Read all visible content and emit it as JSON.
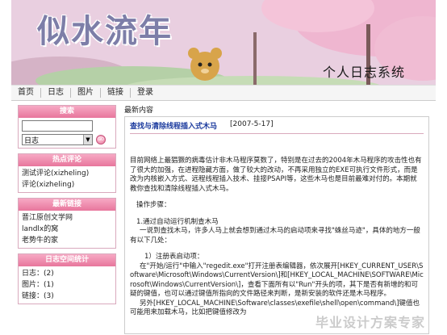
{
  "banner": {
    "title": "似水流年",
    "subtitle": "个人日志系统"
  },
  "nav": [
    "首页",
    "日志",
    "图片",
    "链接",
    "登录"
  ],
  "sidebar": {
    "search": {
      "heading": "搜索",
      "select_value": "日志"
    },
    "comments": {
      "heading": "热点评论",
      "items": [
        "测试评论(xizheling)",
        "评论(xizheling)"
      ]
    },
    "links": {
      "heading": "最新链接",
      "items": [
        "晋江原创文学网",
        "landlx的窝",
        "老势牛的家"
      ]
    },
    "stats": {
      "heading": "日志空间统计",
      "items": [
        "日志：(2)",
        "图片：(1)",
        "链接：(3)"
      ]
    }
  },
  "main": {
    "label": "最新内容",
    "post": {
      "title": "查找与清除线程插入式木马",
      "date": "[2007-5-17]",
      "paragraphs": [
        "目前网络上最猖獗的病毒估计非木马程序莫数了，特别是在过去的2004年木马程序的攻击性也有了很大的加强，在进程隐藏方面，做了较大的改动，不再采用独立的EXE可执行文件形式，而是改为内核嵌入方式、远程线程插入技术、挂接PSAPI等，这些木马也是目前最难对付的。本期就教你查找和清除线程插入式木马。",
        "",
        "操作步骤：",
        "",
        "1.通过自动运行机制查木马",
        "一说到查找木马，许多人马上就会想到通过木马的启动项来寻找\"蛛丝马迹\"，具体的地方一般有以下几处：",
        "",
        "1）注册表启动项：",
        "在\"开始/运行\"中输入\"regedit.exe\"打开注册表编辑器，依次展开[HKEY_CURRENT_USER\\Software\\Microsoft\\Windows\\CurrentVersion\\]和[HKEY_LOCAL_MACHINE\\SOFTWARE\\Microsoft\\Windows\\CurrentVersion\\]，查看下面所有以\"Run\"开头的项，其下是否有新增的和可疑的键值，也可以通过键值所指向的文件路径来判断，是新安装的软件还是木马程序。",
        "另外[HKEY_LOCAL_MACHINE\\Software\\classes\\exefile\\shell\\open\\command\\]键值也可能用来加载木马，比如把键值修改为"
      ]
    },
    "watermark": "毕业设计方案专家"
  },
  "colors": {
    "accent": "#e8769c",
    "title_blue": "#1c3b9e",
    "banner_title": "#7d7ea8"
  }
}
